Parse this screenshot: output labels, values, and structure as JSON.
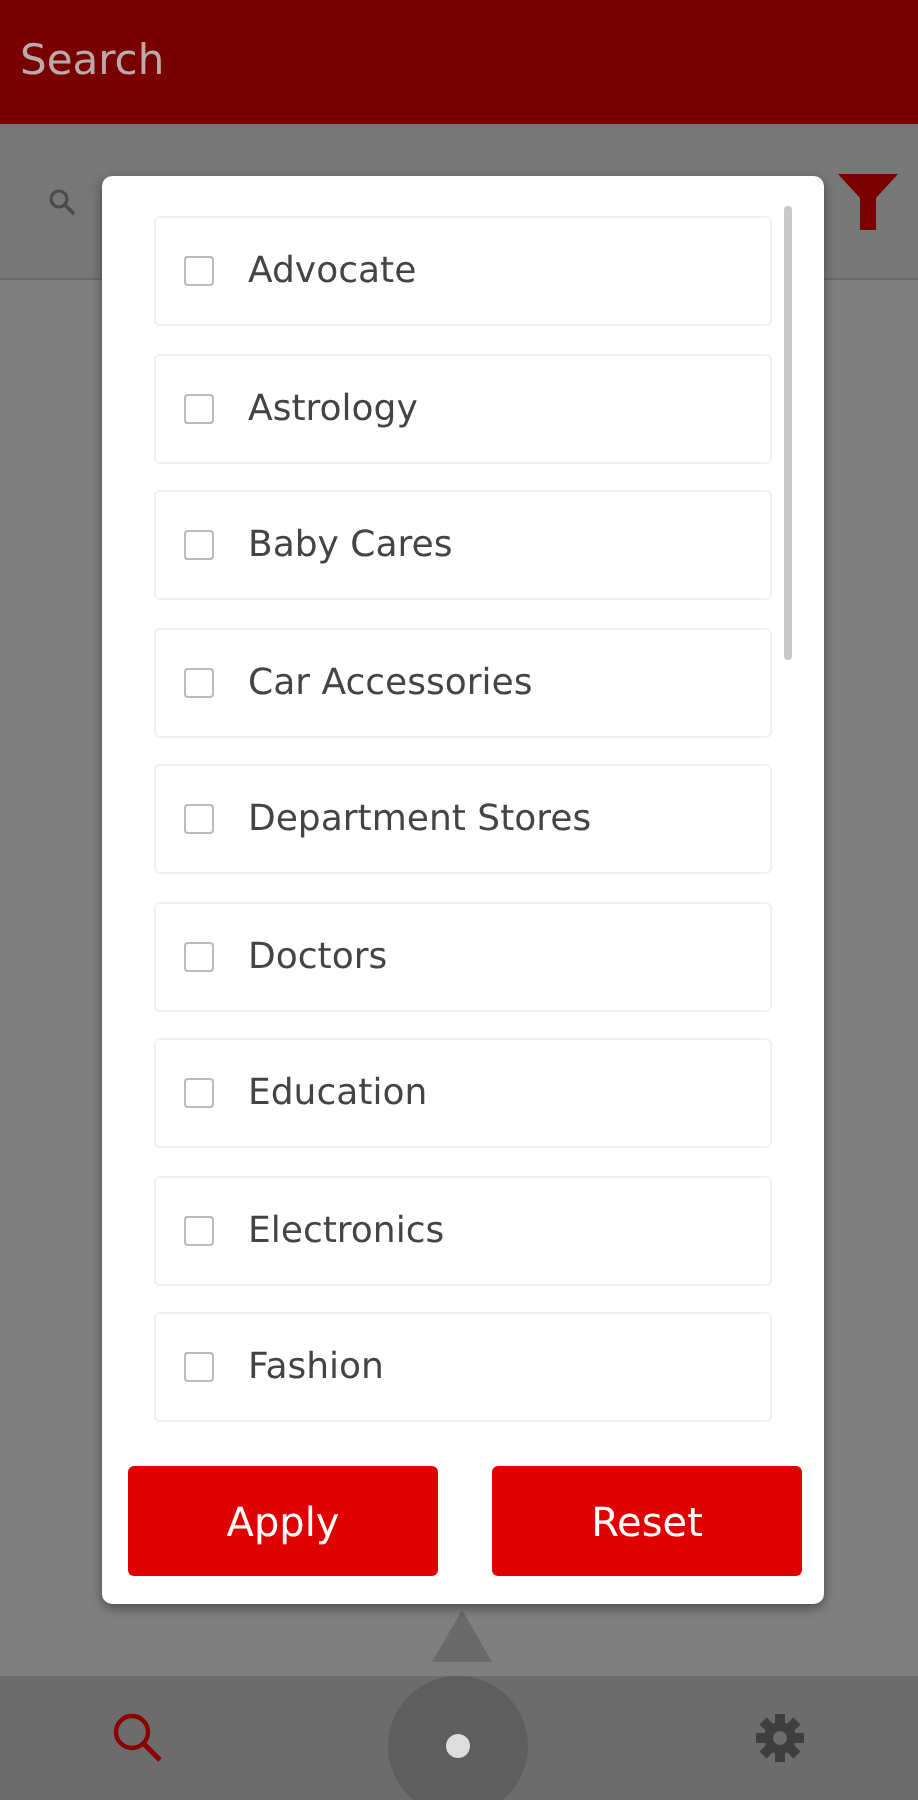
{
  "app_bar": {
    "title": "Search"
  },
  "filter_dialog": {
    "categories": [
      {
        "label": "Advocate",
        "checked": false
      },
      {
        "label": "Astrology",
        "checked": false
      },
      {
        "label": "Baby Cares",
        "checked": false
      },
      {
        "label": "Car Accessories",
        "checked": false
      },
      {
        "label": "Department Stores",
        "checked": false
      },
      {
        "label": "Doctors",
        "checked": false
      },
      {
        "label": "Education",
        "checked": false
      },
      {
        "label": "Electronics",
        "checked": false
      },
      {
        "label": "Fashion",
        "checked": false
      }
    ],
    "buttons": [
      "Apply",
      "Reset"
    ]
  },
  "bottom_nav": [
    {
      "kind": "search",
      "selected": true
    },
    {
      "kind": "home",
      "selected": false
    },
    {
      "kind": "settings",
      "selected": false
    }
  ]
}
